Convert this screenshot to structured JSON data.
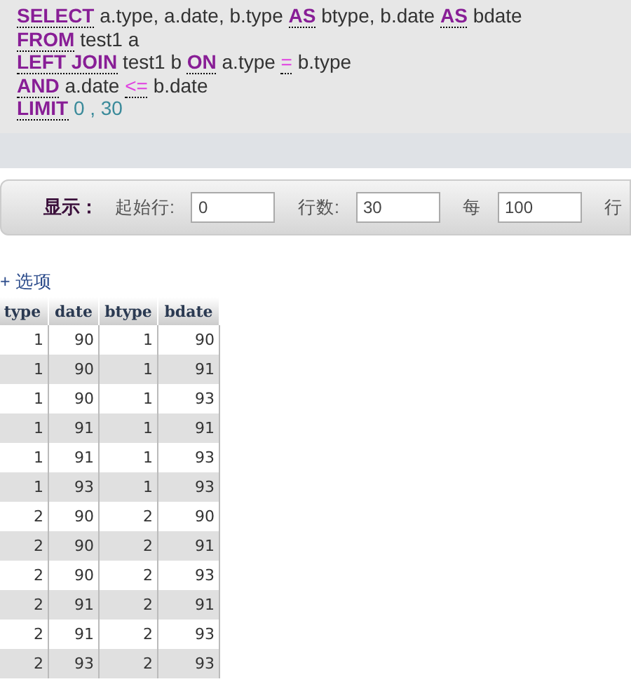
{
  "sql": [
    [
      {
        "kind": "keyword",
        "text": "SELECT"
      },
      {
        "kind": "plain",
        "text": "a.type, a.date, b.type"
      },
      {
        "kind": "keyword",
        "text": "AS"
      },
      {
        "kind": "plain",
        "text": "btype, b.date"
      },
      {
        "kind": "keyword",
        "text": "AS"
      },
      {
        "kind": "plain",
        "text": "bdate"
      }
    ],
    [
      {
        "kind": "keyword",
        "text": "FROM"
      },
      {
        "kind": "plain",
        "text": "test1 a"
      }
    ],
    [
      {
        "kind": "keyword",
        "text": "LEFT JOIN"
      },
      {
        "kind": "plain",
        "text": "test1 b"
      },
      {
        "kind": "keyword",
        "text": "ON"
      },
      {
        "kind": "plain",
        "text": "a.type"
      },
      {
        "kind": "operator",
        "text": "="
      },
      {
        "kind": "plain",
        "text": "b.type"
      }
    ],
    [
      {
        "kind": "keyword",
        "text": "AND"
      },
      {
        "kind": "plain",
        "text": "a.date"
      },
      {
        "kind": "operator",
        "text": "<="
      },
      {
        "kind": "plain",
        "text": "b.date"
      }
    ],
    [
      {
        "kind": "keyword",
        "text": "LIMIT"
      },
      {
        "kind": "number",
        "text": "0 , 30"
      }
    ]
  ],
  "display_bar": {
    "title": "显示：",
    "fields": [
      {
        "label": "起始行:",
        "value": "0"
      },
      {
        "label": "行数:",
        "value": "30"
      },
      {
        "label": "每",
        "value": "100"
      }
    ],
    "trailing": "行"
  },
  "options_link": "+ 选项",
  "table": {
    "columns": [
      "type",
      "date",
      "btype",
      "bdate"
    ],
    "rows": [
      [
        "1",
        "90",
        "1",
        "90"
      ],
      [
        "1",
        "90",
        "1",
        "91"
      ],
      [
        "1",
        "90",
        "1",
        "93"
      ],
      [
        "1",
        "91",
        "1",
        "91"
      ],
      [
        "1",
        "91",
        "1",
        "93"
      ],
      [
        "1",
        "93",
        "1",
        "93"
      ],
      [
        "2",
        "90",
        "2",
        "90"
      ],
      [
        "2",
        "90",
        "2",
        "91"
      ],
      [
        "2",
        "90",
        "2",
        "93"
      ],
      [
        "2",
        "91",
        "2",
        "91"
      ],
      [
        "2",
        "91",
        "2",
        "93"
      ],
      [
        "2",
        "93",
        "2",
        "93"
      ]
    ]
  }
}
